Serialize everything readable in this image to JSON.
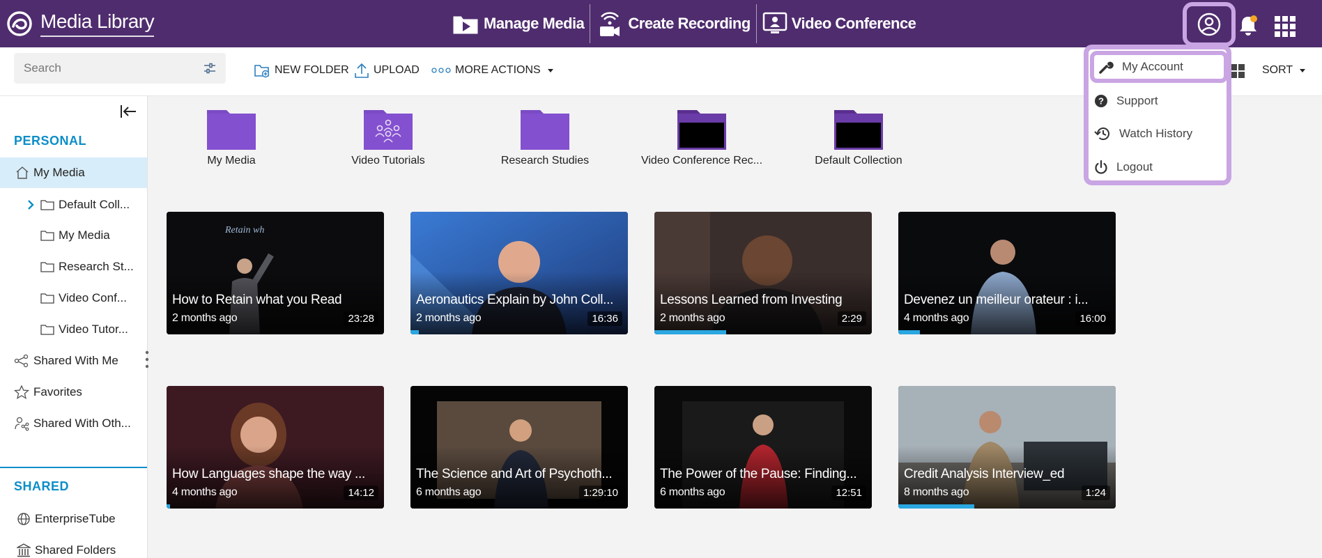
{
  "app": {
    "title": "Media Library",
    "logo_icon": "kaltura-swirl-icon"
  },
  "topnav": [
    {
      "label": "Manage Media",
      "icon": "play-folder-icon"
    },
    {
      "label": "Create Recording",
      "icon": "wireless-camera-icon"
    },
    {
      "label": "Video Conference",
      "icon": "monitor-people-icon"
    }
  ],
  "header": {
    "user_icon": "user-circle-icon",
    "bell_icon": "bell-icon",
    "apps_icon": "grid-apps-icon"
  },
  "toolbar": {
    "search_placeholder": "Search",
    "new_folder": "NEW FOLDER",
    "upload": "UPLOAD",
    "more_actions": "MORE ACTIONS",
    "sort": "SORT"
  },
  "sidebar": {
    "personal_title": "PERSONAL",
    "shared_title": "SHARED",
    "personal": [
      {
        "label": "My Media"
      },
      {
        "label": "Default Coll..."
      },
      {
        "label": "My Media"
      },
      {
        "label": "Research St..."
      },
      {
        "label": "Video Conf..."
      },
      {
        "label": "Video Tutor..."
      },
      {
        "label": "Shared With Me"
      },
      {
        "label": "Favorites"
      },
      {
        "label": "Shared With Oth..."
      }
    ],
    "shared": [
      {
        "label": "EnterpriseTube"
      },
      {
        "label": "Shared Folders"
      }
    ]
  },
  "folders": [
    {
      "name": "My Media"
    },
    {
      "name": "Video Tutorials"
    },
    {
      "name": "Research Studies"
    },
    {
      "name": "Video Conference Rec..."
    },
    {
      "name": "Default Collection"
    }
  ],
  "media": [
    {
      "title": "How to Retain what you Read",
      "age": "2 months ago",
      "duration": "23:28",
      "progress": 0
    },
    {
      "title": "Aeronautics Explain by John Coll...",
      "age": "2 months ago",
      "duration": "16:36",
      "progress": 0.04
    },
    {
      "title": "Lessons Learned from Investing",
      "age": "2 months ago",
      "duration": "2:29",
      "progress": 0.33
    },
    {
      "title": "Devenez un meilleur orateur : i...",
      "age": "4 months ago",
      "duration": "16:00",
      "progress": 0.1
    },
    {
      "title": "How Languages shape the way ...",
      "age": "4 months ago",
      "duration": "14:12",
      "progress": 0.015
    },
    {
      "title": "The Science and Art of Psychoth...",
      "age": "6 months ago",
      "duration": "1:29:10",
      "progress": 0
    },
    {
      "title": "The Power of the Pause: Finding...",
      "age": "6 months ago",
      "duration": "12:51",
      "progress": 0
    },
    {
      "title": "Credit Analysis Interview_ed",
      "age": "8 months ago",
      "duration": "1:24",
      "progress": 0.35
    }
  ],
  "user_menu": [
    {
      "label": "My Account",
      "icon": "wrench-icon"
    },
    {
      "label": "Support",
      "icon": "help-circle-icon"
    },
    {
      "label": "Watch History",
      "icon": "history-icon"
    },
    {
      "label": "Logout",
      "icon": "power-icon"
    }
  ],
  "colors": {
    "topbar": "#4f2c6e",
    "accent": "#0c8ec8",
    "highlight": "#c9a5e3",
    "folder": "#7b4bc4",
    "progress": "#2aa7e0"
  }
}
